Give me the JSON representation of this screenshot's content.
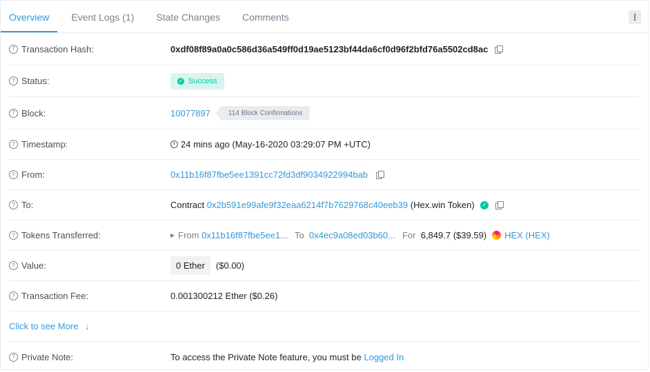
{
  "tabs": [
    {
      "label": "Overview",
      "active": true
    },
    {
      "label": "Event Logs (1)",
      "active": false
    },
    {
      "label": "State Changes",
      "active": false
    },
    {
      "label": "Comments",
      "active": false
    }
  ],
  "menu_icon": "more-vertical-icon",
  "rows": {
    "hash": {
      "label": "Transaction Hash:",
      "value": "0xdf08f89a0a0c586d36a549ff0d19ae5123bf44da6cf0d96f2bfd76a5502cd8ac"
    },
    "status": {
      "label": "Status:",
      "value": "Success"
    },
    "block": {
      "label": "Block:",
      "value": "10077897",
      "confirmations": "114 Block Confirmations"
    },
    "timestamp": {
      "label": "Timestamp:",
      "value": "24 mins ago (May-16-2020 03:29:07 PM +UTC)"
    },
    "from": {
      "label": "From:",
      "value": "0x11b16f87fbe5ee1391cc72fd3df9034922994bab"
    },
    "to": {
      "label": "To:",
      "prefix": "Contract",
      "value": "0x2b591e99afe9f32eaa6214f7b7629768c40eeb39",
      "suffix": "(Hex.win Token)"
    },
    "tokens": {
      "label": "Tokens Transferred:",
      "from_label": "From",
      "from_value": "0x11b16f87fbe5ee1...",
      "to_label": "To",
      "to_value": "0x4ec9a08ed03b60...",
      "for_label": "For",
      "amount": "6,849.7 ($39.59)",
      "token": "HEX (HEX)"
    },
    "value": {
      "label": "Value:",
      "ether": "0 Ether",
      "usd": "($0.00)"
    },
    "fee": {
      "label": "Transaction Fee:",
      "value": "0.001300212 Ether ($0.26)"
    },
    "more": {
      "label": "Click to see More"
    },
    "note": {
      "label": "Private Note:",
      "text": "To access the Private Note feature, you must be",
      "link": "Logged In"
    }
  },
  "colors": {
    "accent": "#3498db",
    "success": "#00c9a7"
  }
}
